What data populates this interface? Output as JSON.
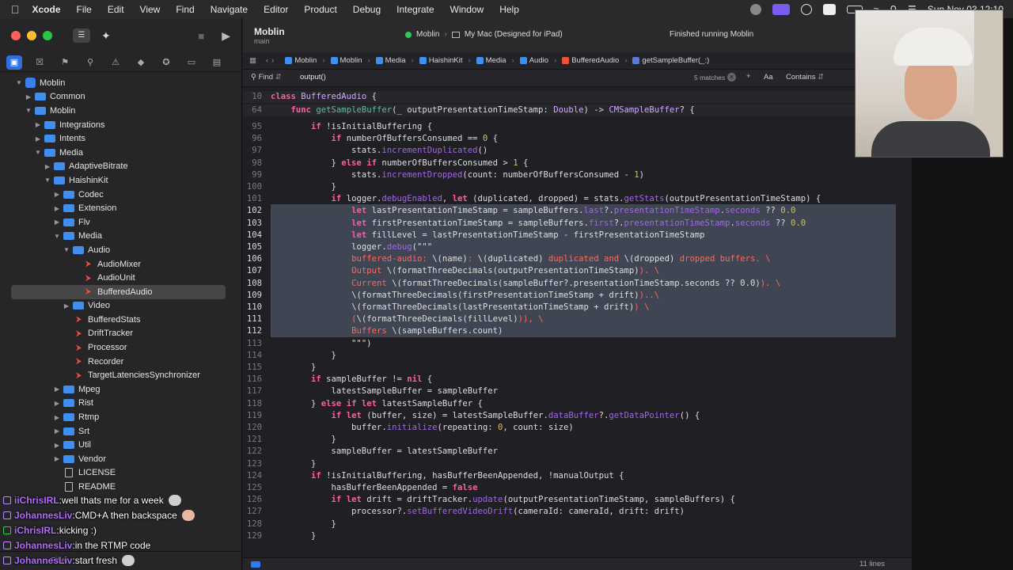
{
  "menubar": {
    "app": "Xcode",
    "items": [
      "File",
      "Edit",
      "View",
      "Find",
      "Navigate",
      "Editor",
      "Product",
      "Debug",
      "Integrate",
      "Window",
      "Help"
    ],
    "clock": "Sun Nov 03 12:10"
  },
  "toolbar": {
    "project": "Moblin",
    "branch": "main",
    "scheme": "Moblin",
    "destination": "My Mac (Designed for iPad)",
    "status": "Finished running Moblin"
  },
  "jumpbar": [
    "Moblin",
    "Moblin",
    "Media",
    "HaishinKit",
    "Media",
    "Audio",
    "BufferedAudio",
    "getSampleBuffer(_:)"
  ],
  "findbar": {
    "mode": "Find",
    "query": "output()",
    "matches": "5 matches",
    "case_label": "Aa",
    "match_type": "Contains"
  },
  "navigator": {
    "items": [
      {
        "label": "Moblin",
        "kind": "project",
        "level": 0,
        "open": true
      },
      {
        "label": "Common",
        "kind": "folder",
        "level": 1,
        "open": false
      },
      {
        "label": "Moblin",
        "kind": "folder",
        "level": 1,
        "open": true
      },
      {
        "label": "Integrations",
        "kind": "folder",
        "level": 2,
        "open": false
      },
      {
        "label": "Intents",
        "kind": "folder",
        "level": 2,
        "open": false
      },
      {
        "label": "Media",
        "kind": "folder",
        "level": 2,
        "open": true
      },
      {
        "label": "AdaptiveBitrate",
        "kind": "folder",
        "level": 3,
        "open": false
      },
      {
        "label": "HaishinKit",
        "kind": "folder",
        "level": 3,
        "open": true
      },
      {
        "label": "Codec",
        "kind": "folder",
        "level": 4,
        "open": false
      },
      {
        "label": "Extension",
        "kind": "folder",
        "level": 4,
        "open": false
      },
      {
        "label": "Flv",
        "kind": "folder",
        "level": 4,
        "open": false
      },
      {
        "label": "Media",
        "kind": "folder",
        "level": 4,
        "open": true
      },
      {
        "label": "Audio",
        "kind": "folder",
        "level": 5,
        "open": true
      },
      {
        "label": "AudioMixer",
        "kind": "swift",
        "level": 6
      },
      {
        "label": "AudioUnit",
        "kind": "swift",
        "level": 6
      },
      {
        "label": "BufferedAudio",
        "kind": "swift",
        "level": 6,
        "selected": true
      },
      {
        "label": "Video",
        "kind": "folder",
        "level": 5,
        "open": false
      },
      {
        "label": "BufferedStats",
        "kind": "swift",
        "level": 5
      },
      {
        "label": "DriftTracker",
        "kind": "swift",
        "level": 5
      },
      {
        "label": "Processor",
        "kind": "swift",
        "level": 5
      },
      {
        "label": "Recorder",
        "kind": "swift",
        "level": 5
      },
      {
        "label": "TargetLatenciesSynchronizer",
        "kind": "swift",
        "level": 5
      },
      {
        "label": "Mpeg",
        "kind": "folder",
        "level": 4,
        "open": false
      },
      {
        "label": "Rist",
        "kind": "folder",
        "level": 4,
        "open": false
      },
      {
        "label": "Rtmp",
        "kind": "folder",
        "level": 4,
        "open": false
      },
      {
        "label": "Srt",
        "kind": "folder",
        "level": 4,
        "open": false
      },
      {
        "label": "Util",
        "kind": "folder",
        "level": 4,
        "open": false
      },
      {
        "label": "Vendor",
        "kind": "folder",
        "level": 4,
        "open": false
      },
      {
        "label": "LICENSE",
        "kind": "doc",
        "level": 4
      },
      {
        "label": "README",
        "kind": "doc",
        "level": 4
      }
    ],
    "filter_placeholder": "Filter"
  },
  "chat": [
    {
      "user": "iiChrisIRL",
      "msg": "well thats me for a week",
      "badge": "purple",
      "emote": true
    },
    {
      "user": "JohannesLiv",
      "msg": "CMD+A then backspace",
      "badge": "purple",
      "emote": true
    },
    {
      "user": "iChrisIRL",
      "msg": "kicking :)",
      "badge": "green",
      "emote": false
    },
    {
      "user": "JohannesLiv",
      "msg": "in the RTMP code",
      "badge": "purple",
      "emote": false
    },
    {
      "user": "JohannesLiv",
      "msg": "start fresh",
      "badge": "purple",
      "emote": true
    }
  ],
  "code": {
    "lines": [
      {
        "n": "10",
        "text": "class BufferedAudio {",
        "sticky": true
      },
      {
        "n": "64",
        "text": "    func getSampleBuffer(_ outputPresentationTimeStamp: Double) -> CMSampleBuffer? {",
        "sticky": true
      },
      {
        "n": "95",
        "text": "        if !isInitialBuffering {"
      },
      {
        "n": "96",
        "text": "            if numberOfBuffersConsumed == 0 {"
      },
      {
        "n": "97",
        "text": "                stats.incrementDuplicated()"
      },
      {
        "n": "98",
        "text": "            } else if numberOfBuffersConsumed > 1 {"
      },
      {
        "n": "99",
        "text": "                stats.incrementDropped(count: numberOfBuffersConsumed - 1)"
      },
      {
        "n": "100",
        "text": "            }"
      },
      {
        "n": "101",
        "text": "            if logger.debugEnabled, let (duplicated, dropped) = stats.getStats(outputPresentationTimeStamp) {"
      },
      {
        "n": "102",
        "text": "                let lastPresentationTimeStamp = sampleBuffers.last?.presentationTimeStamp.seconds ?? 0.0"
      },
      {
        "n": "103",
        "text": "                let firstPresentationTimeStamp = sampleBuffers.first?.presentationTimeStamp.seconds ?? 0.0"
      },
      {
        "n": "104",
        "text": "                let fillLevel = lastPresentationTimeStamp - firstPresentationTimeStamp"
      },
      {
        "n": "105",
        "text": "                logger.debug(\"\"\""
      },
      {
        "n": "106",
        "text": "                buffered-audio: \\(name): \\(duplicated) duplicated and \\(dropped) dropped buffers. \\"
      },
      {
        "n": "107",
        "text": "                Output \\(formatThreeDecimals(outputPresentationTimeStamp)). \\"
      },
      {
        "n": "108",
        "text": "                Current \\(formatThreeDecimals(sampleBuffer?.presentationTimeStamp.seconds ?? 0.0)). \\"
      },
      {
        "n": "109",
        "text": "                \\(formatThreeDecimals(firstPresentationTimeStamp + drift))..\\"
      },
      {
        "n": "110",
        "text": "                \\(formatThreeDecimals(lastPresentationTimeStamp + drift)) \\"
      },
      {
        "n": "111",
        "text": "                (\\(formatThreeDecimals(fillLevel))), \\"
      },
      {
        "n": "112",
        "text": "                Buffers \\(sampleBuffers.count)"
      },
      {
        "n": "113",
        "text": "                \"\"\")"
      },
      {
        "n": "114",
        "text": "            }"
      },
      {
        "n": "115",
        "text": "        }"
      },
      {
        "n": "116",
        "text": "        if sampleBuffer != nil {"
      },
      {
        "n": "117",
        "text": "            latestSampleBuffer = sampleBuffer"
      },
      {
        "n": "118",
        "text": "        } else if let latestSampleBuffer {"
      },
      {
        "n": "119",
        "text": "            if let (buffer, size) = latestSampleBuffer.dataBuffer?.getDataPointer() {"
      },
      {
        "n": "120",
        "text": "                buffer.initialize(repeating: 0, count: size)"
      },
      {
        "n": "121",
        "text": "            }"
      },
      {
        "n": "122",
        "text": "            sampleBuffer = latestSampleBuffer"
      },
      {
        "n": "123",
        "text": "        }"
      },
      {
        "n": "124",
        "text": "        if !isInitialBuffering, hasBufferBeenAppended, !manualOutput {"
      },
      {
        "n": "125",
        "text": "            hasBufferBeenAppended = false"
      },
      {
        "n": "126",
        "text": "            if let drift = driftTracker.update(outputPresentationTimeStamp, sampleBuffers) {"
      },
      {
        "n": "127",
        "text": "                processor?.setBufferedVideoDrift(cameraId: cameraId, drift: drift)"
      },
      {
        "n": "128",
        "text": "            }"
      },
      {
        "n": "129",
        "text": "        }"
      }
    ]
  },
  "status_bar": {
    "lines": "11 lines"
  },
  "colors": {
    "accent": "#2f6fe0",
    "keyword": "#fc5fa3",
    "string": "#fc6a5d",
    "type": "#d0a8ff",
    "function": "#67b7a4",
    "selection": "#3f4552"
  }
}
